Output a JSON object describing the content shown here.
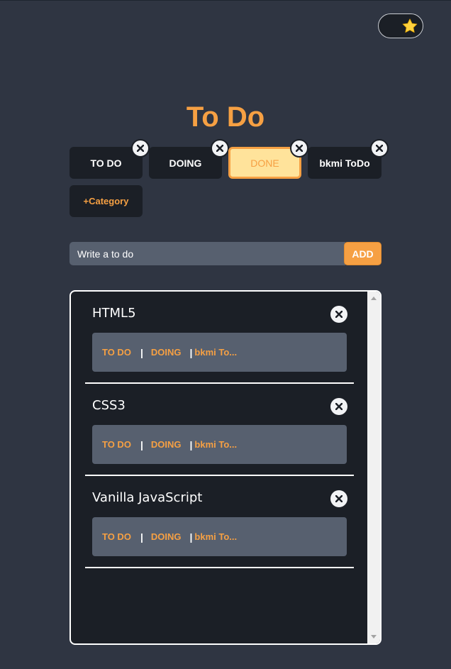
{
  "theme_toggle": {
    "icon": "star-icon",
    "color": "#ffd23f"
  },
  "title": "To Do",
  "categories": [
    {
      "label": "TO DO",
      "active": false
    },
    {
      "label": "DOING",
      "active": false
    },
    {
      "label": "DONE",
      "active": true
    },
    {
      "label": "bkmi ToDo",
      "active": false
    }
  ],
  "add_category_label": "+Category",
  "input": {
    "placeholder": "Write a to do",
    "value": ""
  },
  "add_button_label": "ADD",
  "todos": [
    {
      "name": "HTML5",
      "moves": [
        "TO DO",
        "DOING",
        "bkmi To..."
      ]
    },
    {
      "name": "CSS3",
      "moves": [
        "TO DO",
        "DOING",
        "bkmi To..."
      ]
    },
    {
      "name": "Vanilla JavaScript",
      "moves": [
        "TO DO",
        "DOING",
        "bkmi To..."
      ]
    }
  ],
  "separator": "|",
  "colors": {
    "accent": "#f6a043",
    "background": "#2f3542",
    "panel": "#1b1f26",
    "field": "#57606f",
    "active_category": "#ffe39b"
  }
}
